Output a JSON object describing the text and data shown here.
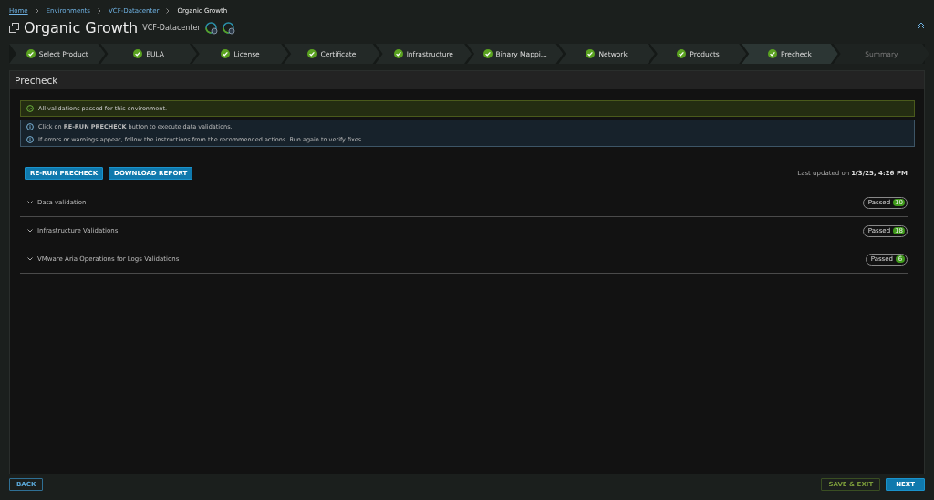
{
  "breadcrumb": [
    {
      "label": "Home",
      "link": true
    },
    {
      "label": "Environments",
      "link": true
    },
    {
      "label": "VCF-Datacenter",
      "link": true
    },
    {
      "label": "Organic Growth",
      "link": false
    }
  ],
  "header": {
    "title": "Organic Growth",
    "subtitle": "VCF-Datacenter"
  },
  "steps": [
    {
      "label": "Select Product",
      "completed": true,
      "selected": false
    },
    {
      "label": "EULA",
      "completed": true,
      "selected": false
    },
    {
      "label": "License",
      "completed": true,
      "selected": false
    },
    {
      "label": "Certificate",
      "completed": true,
      "selected": false
    },
    {
      "label": "Infrastructure",
      "completed": true,
      "selected": false
    },
    {
      "label": "Binary Mappi...",
      "completed": true,
      "selected": false
    },
    {
      "label": "Network",
      "completed": true,
      "selected": false
    },
    {
      "label": "Products",
      "completed": true,
      "selected": false
    },
    {
      "label": "Precheck",
      "completed": true,
      "selected": true
    },
    {
      "label": "Summary",
      "completed": false,
      "selected": false
    }
  ],
  "panel": {
    "title": "Precheck",
    "success_alert": "All validations passed for this environment.",
    "info_alerts": [
      "Click on **RE-RUN PRECHECK** button to execute data validations.",
      "If errors or warnings appear, follow the instructions from the recommended actions. Run again to verify fixes."
    ],
    "buttons": [
      "RE-RUN PRECHECK",
      "DOWNLOAD REPORT"
    ],
    "last_updated": "Last updated on **1/3/25, 4:26 PM**",
    "validations": [
      {
        "name": "Data validation",
        "expanded": false,
        "status": "Passed",
        "count": "10"
      },
      {
        "name": "Infrastructure Validations",
        "expanded": false,
        "status": "Passed",
        "count": "18"
      },
      {
        "name": "VMware Aria Operations for Logs Validations",
        "expanded": false,
        "status": "Passed",
        "count": "6"
      }
    ]
  },
  "footer": {
    "back": "BACK",
    "save": "SAVE & EXIT",
    "next": "NEXT"
  }
}
